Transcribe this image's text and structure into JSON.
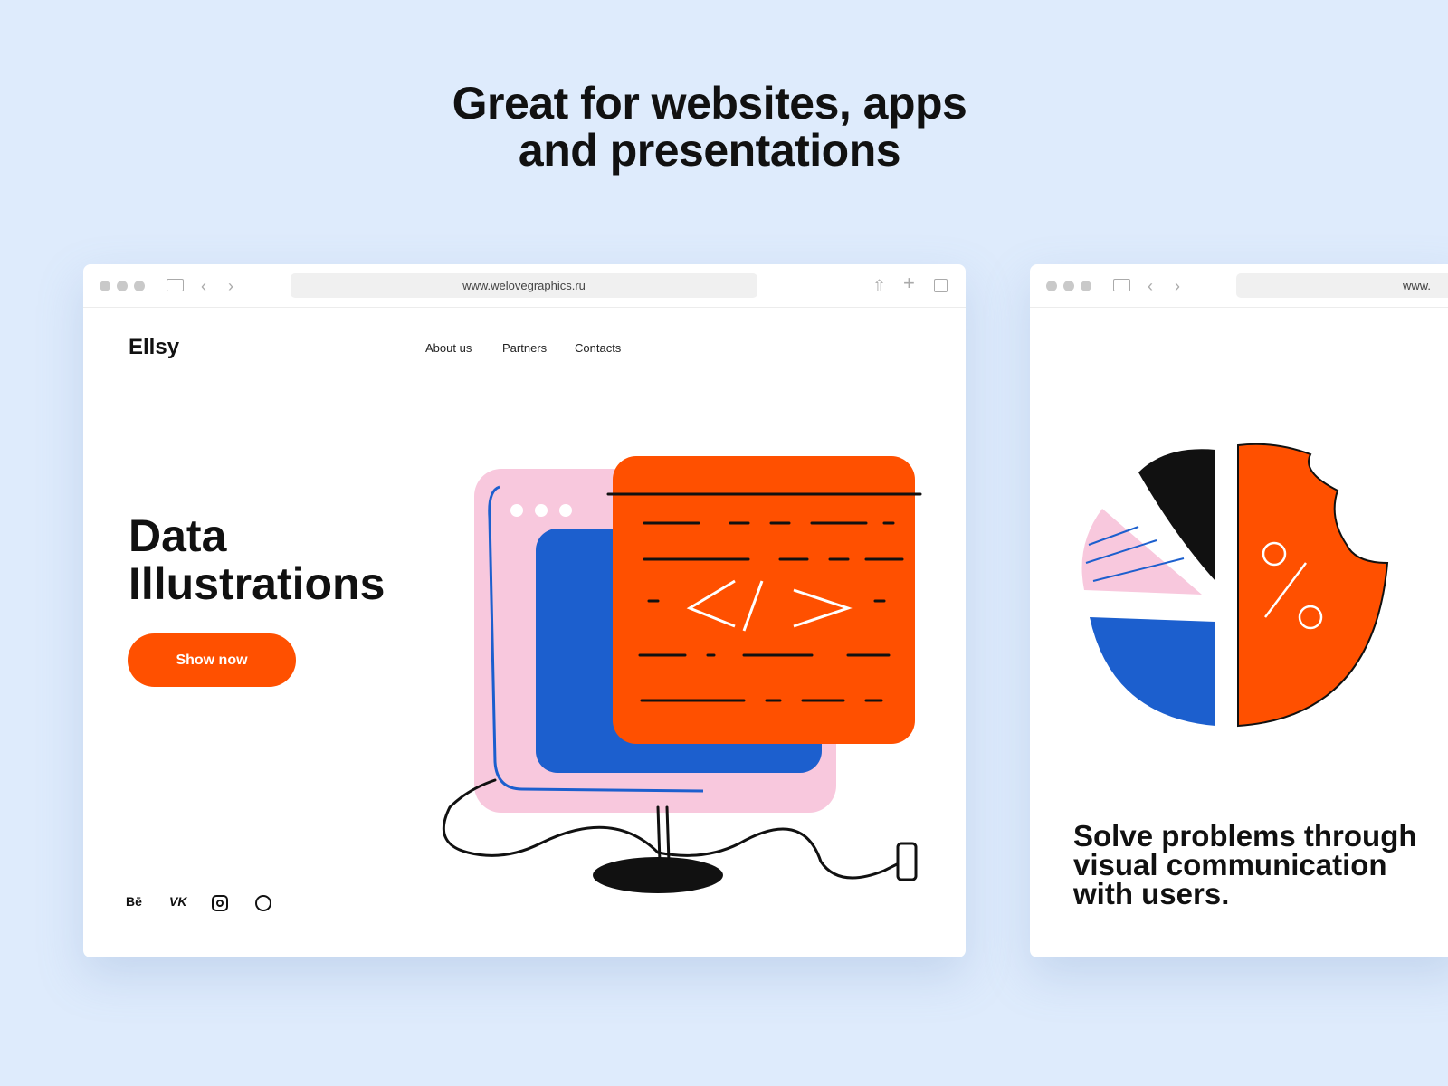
{
  "headline": {
    "line1": "Great for websites, apps",
    "line2": "and presentations"
  },
  "browser1": {
    "url": "www.welovegraphics.ru",
    "logo": "Ellsy",
    "nav": [
      "About us",
      "Partners",
      "Contacts"
    ],
    "hero_title_line1": "Data",
    "hero_title_line2": "Illustrations",
    "cta": "Show now",
    "social": [
      "Bē",
      "VK",
      "instagram-icon",
      "dribbble-icon"
    ]
  },
  "browser2": {
    "url": "www.",
    "tagline": "Solve problems through visual communication with users."
  },
  "colors": {
    "accent": "#ff5000",
    "blue": "#1c5fce",
    "pink": "#f8c8dd",
    "background": "#deebfc"
  }
}
